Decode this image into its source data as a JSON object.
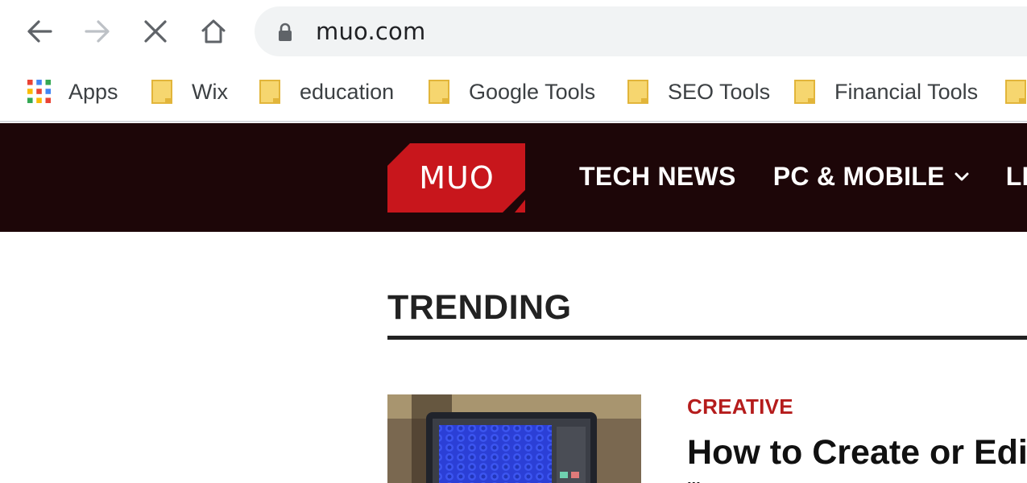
{
  "browser": {
    "url": "muo.com",
    "buttons": {
      "back": "back-arrow-icon",
      "forward": "forward-arrow-icon",
      "stop": "close-icon",
      "home": "home-icon"
    }
  },
  "bookmarks": [
    {
      "label": "Apps",
      "icon": "apps-grid-icon"
    },
    {
      "label": "Wix",
      "icon": "folder-icon"
    },
    {
      "label": "education",
      "icon": "folder-icon"
    },
    {
      "label": "Google Tools",
      "icon": "folder-icon"
    },
    {
      "label": "SEO Tools",
      "icon": "folder-icon"
    },
    {
      "label": "Financial Tools",
      "icon": "folder-icon"
    }
  ],
  "site": {
    "logo_text": "MUO",
    "nav": [
      {
        "label": "TECH NEWS"
      },
      {
        "label": "PC & MOBILE"
      },
      {
        "label": "LI"
      }
    ],
    "colors": {
      "header_bg": "#1d0608",
      "logo_red": "#c8161c",
      "category_red": "#b51c1c"
    }
  },
  "content": {
    "section_title": "TRENDING",
    "article": {
      "category": "CREATIVE",
      "title": "How to Create or Edit",
      "title_more": "..."
    }
  }
}
